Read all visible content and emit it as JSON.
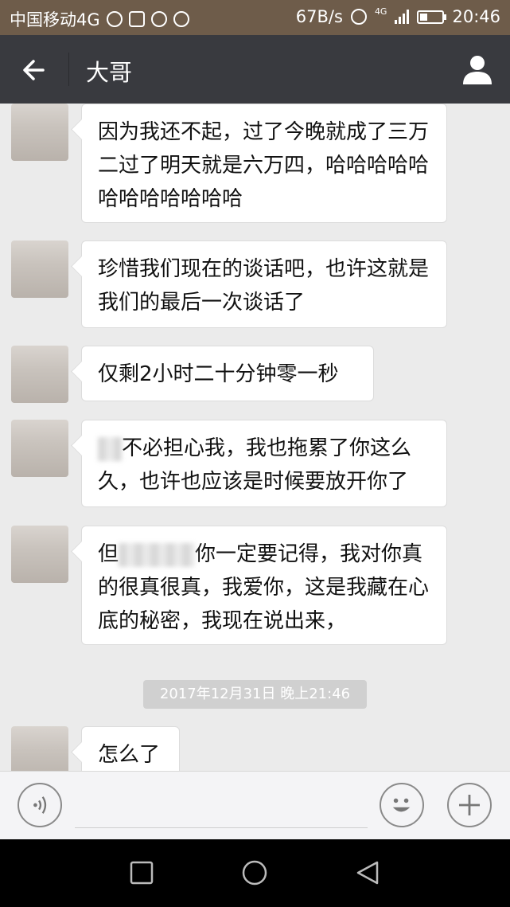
{
  "status_bar": {
    "carrier": "中国移动4G",
    "net_speed": "67B/s",
    "network_badge": "4G",
    "time": "20:46"
  },
  "header": {
    "title": "大哥",
    "back_icon": "back-arrow-icon",
    "profile_icon": "person-icon"
  },
  "messages": [
    {
      "text": "因为我还不起，过了今晚就成了三万二过了明天就是六万四，哈哈哈哈哈哈哈哈哈哈哈哈"
    },
    {
      "text": "珍惜我们现在的谈话吧，也许这就是我们的最后一次谈话了"
    },
    {
      "text": "仅剩2小时二十分钟零一秒"
    },
    {
      "text": "不必担心我，我也拖累了你这么久，也许也应该是时候要放开你了"
    },
    {
      "prefix": "但",
      "text": "你一定要记得，我对你真的很真很真，我爱你，这是我藏在心底的秘密，我现在说出来，"
    },
    {
      "text": "怎么了"
    }
  ],
  "timestamp": "2017年12月31日 晚上21:46",
  "input_bar": {
    "voice_icon": "voice-icon",
    "emoji_icon": "emoji-icon",
    "plus_icon": "plus-icon",
    "placeholder": ""
  },
  "nav_bar": {
    "recents_icon": "square-icon",
    "home_icon": "circle-icon",
    "back_icon": "triangle-back-icon"
  },
  "colors": {
    "status_bar": "#6e5c4a",
    "title_bar": "#393a3f",
    "chat_bg": "#ebebeb",
    "bubble": "#ffffff",
    "timestamp_bg": "#d0d0d0"
  }
}
